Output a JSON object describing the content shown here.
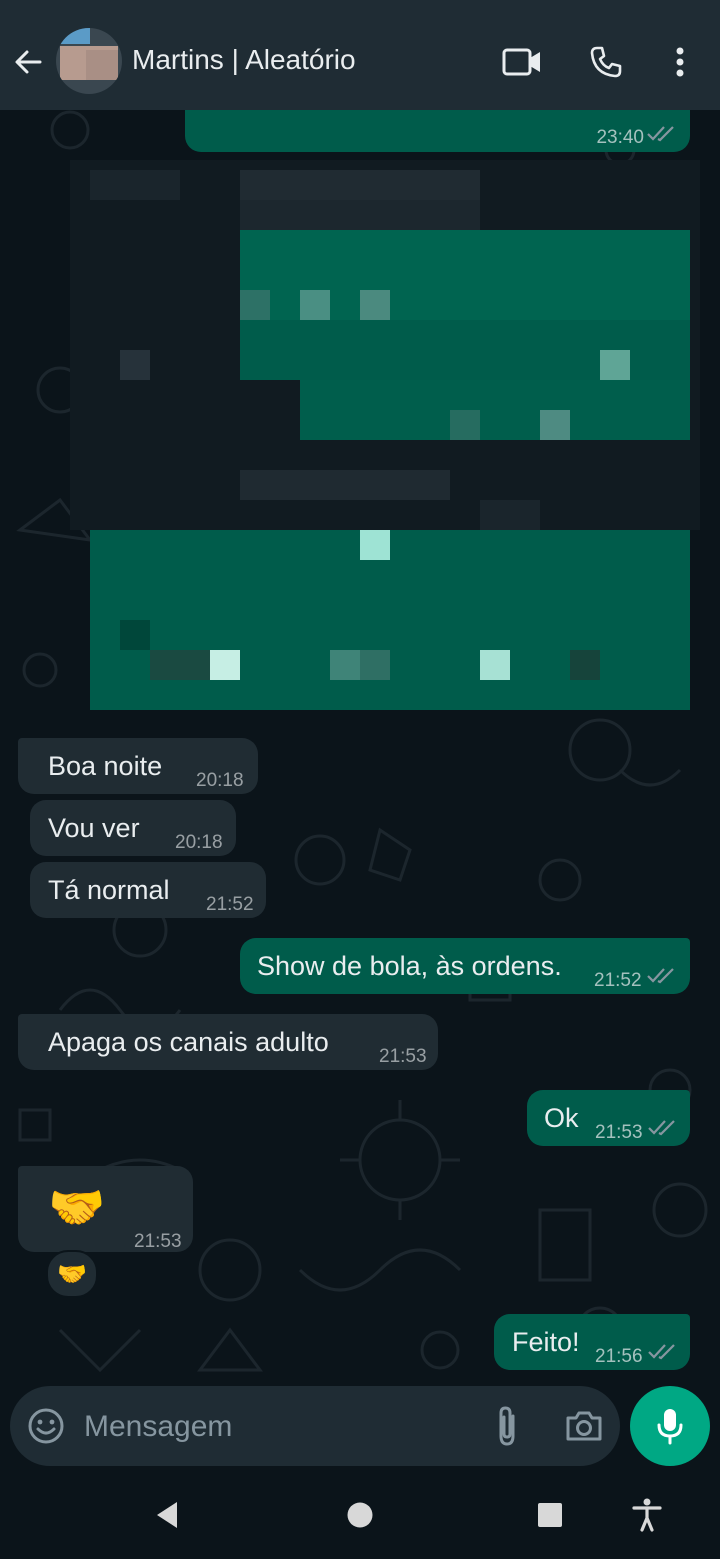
{
  "header": {
    "title": "Martins | Aleatório",
    "icons": [
      "back-arrow-icon",
      "video-call-icon",
      "phone-call-icon",
      "more-options-icon"
    ]
  },
  "messages": [
    {
      "id": "m0",
      "direction": "out",
      "time": "23:40",
      "status": "read"
    },
    {
      "id": "m1",
      "direction": "in",
      "text": "Boa noite",
      "time": "20:18"
    },
    {
      "id": "m2",
      "direction": "in",
      "text": "Vou ver",
      "time": "20:18"
    },
    {
      "id": "m3",
      "direction": "in",
      "text": "Tá normal",
      "time": "21:52"
    },
    {
      "id": "m4",
      "direction": "out",
      "text": "Show de bola, às ordens.",
      "time": "21:52",
      "status": "read"
    },
    {
      "id": "m5",
      "direction": "in",
      "text": "Apaga os canais adulto",
      "time": "21:53"
    },
    {
      "id": "m6",
      "direction": "out",
      "text": "Ok",
      "time": "21:53",
      "status": "read"
    },
    {
      "id": "m7",
      "direction": "in",
      "text": "🤝",
      "time": "21:53",
      "reaction": "🤝"
    },
    {
      "id": "m8",
      "direction": "out",
      "text": "Feito!",
      "time": "21:56",
      "status": "read"
    }
  ],
  "composer": {
    "placeholder": "Mensagem",
    "icons": [
      "emoji-icon",
      "attach-icon",
      "camera-icon",
      "mic-icon"
    ]
  },
  "navigation": {
    "icons": [
      "nav-back-icon",
      "nav-home-icon",
      "nav-recents-icon",
      "accessibility-icon"
    ]
  },
  "colors": {
    "header_bg": "#1f2c34",
    "chat_bg": "#0b141a",
    "incoming_bubble": "#202c33",
    "outgoing_bubble": "#005c4b",
    "accent": "#00a884",
    "read_ticks": "#8696a0"
  }
}
